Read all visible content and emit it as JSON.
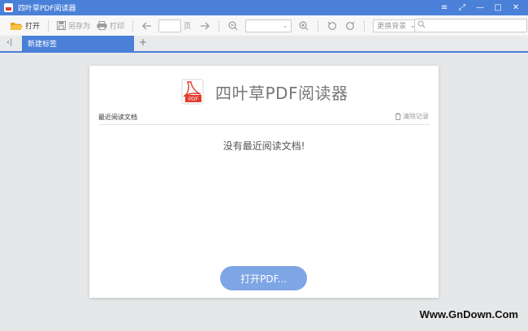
{
  "window": {
    "title": "四叶草PDF阅读器"
  },
  "toolbar": {
    "open": "打开",
    "save_as": "另存为",
    "print": "打印",
    "page_unit": "页",
    "background": "更换背景"
  },
  "tabs": [
    {
      "label": "新建标签"
    }
  ],
  "main": {
    "app_name": "四叶草PDF阅读器",
    "logo_text": "PDF",
    "recent_title": "最近阅读文档",
    "clear_records": "清除记录",
    "empty_message": "没有最近阅读文档!",
    "open_button": "打开PDF..."
  },
  "watermark": "Www.GnDown.Com",
  "colors": {
    "accent": "#4a80d8",
    "open_button": "#7ea5e4",
    "pdf_red": "#e23b2f"
  }
}
